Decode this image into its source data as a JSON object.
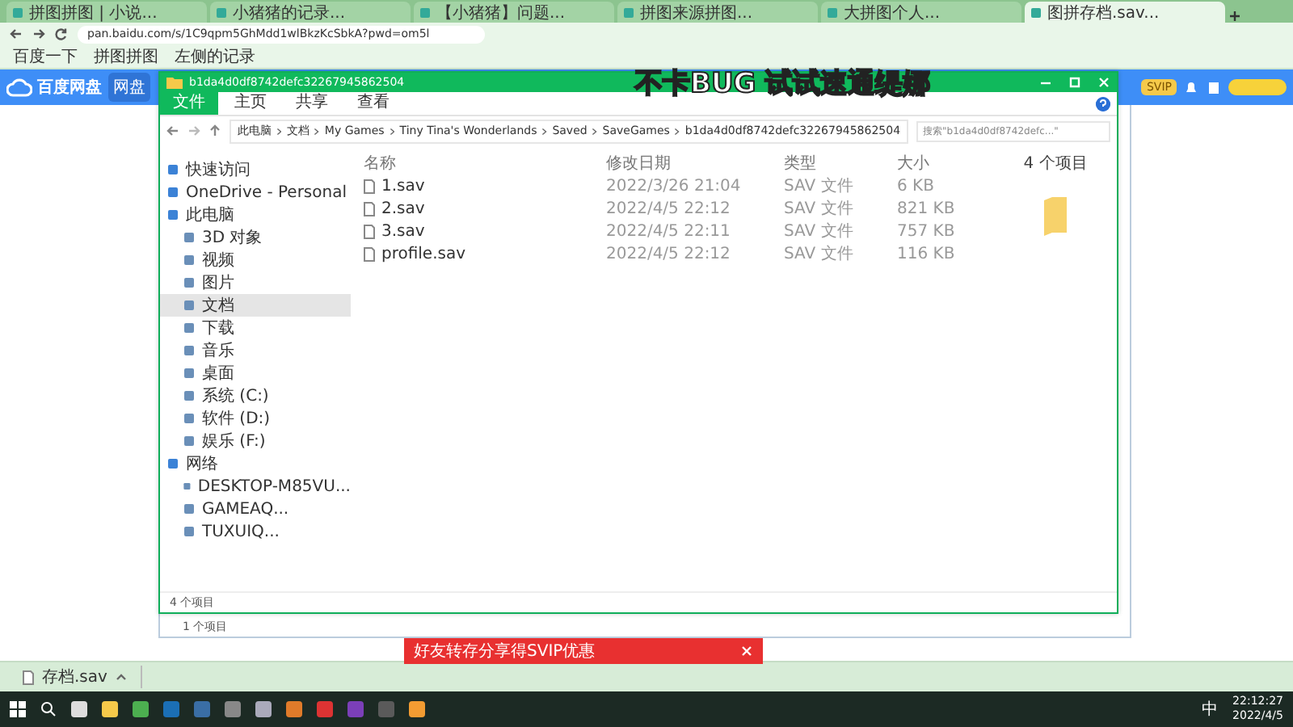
{
  "browser": {
    "tabs": [
      {
        "label": "拼图拼图 | 小说...",
        "selected": false
      },
      {
        "label": "小猪猪的记录...",
        "selected": false
      },
      {
        "label": "【小猪猪】问题...",
        "selected": false
      },
      {
        "label": "拼图来源拼图...",
        "selected": false
      },
      {
        "label": "大拼图个人...",
        "selected": false
      },
      {
        "label": "图拼存档.sav...",
        "selected": true
      }
    ],
    "address": "pan.baidu.com/s/1C9qpm5GhMdd1wlBkzKcSbkA?pwd=om5l",
    "bookmarks": [
      "百度一下",
      "拼图拼图",
      "左侧的记录"
    ]
  },
  "baidu": {
    "logo": "百度网盘",
    "nav": [
      {
        "label": "网盘",
        "selected": true
      }
    ],
    "badge": "SVIP"
  },
  "caption": "不卡BUG 试试速通缇娜",
  "explorer": {
    "title": "b1da4d0df8742defc32267945862504",
    "ribbon": [
      {
        "label": "文件",
        "selected": true
      },
      {
        "label": "主页",
        "selected": false
      },
      {
        "label": "共享",
        "selected": false
      },
      {
        "label": "查看",
        "selected": false
      }
    ],
    "breadcrumb": [
      "此电脑",
      "文档",
      "My Games",
      "Tiny Tina's Wonderlands",
      "Saved",
      "SaveGames",
      "b1da4d0df8742defc32267945862504"
    ],
    "search": {
      "placeholder": "搜索\"b1da4d0df8742defc...\""
    },
    "tree": [
      {
        "label": "快速访问",
        "selected": false
      },
      {
        "label": "OneDrive - Personal",
        "selected": false
      },
      {
        "label": "此电脑",
        "selected": false,
        "children": [
          {
            "label": "3D 对象",
            "selected": false
          },
          {
            "label": "视频",
            "selected": false
          },
          {
            "label": "图片",
            "selected": false
          },
          {
            "label": "文档",
            "selected": true
          },
          {
            "label": "下载",
            "selected": false
          },
          {
            "label": "音乐",
            "selected": false
          },
          {
            "label": "桌面",
            "selected": false
          },
          {
            "label": "系统 (C:)",
            "selected": false
          },
          {
            "label": "软件 (D:)",
            "selected": false
          },
          {
            "label": "娱乐 (F:)",
            "selected": false
          }
        ]
      },
      {
        "label": "网络",
        "selected": false,
        "children": [
          {
            "label": "DESKTOP-M85VU...",
            "selected": false
          },
          {
            "label": "GAMEAQ...",
            "selected": false
          },
          {
            "label": "TUXUIQ...",
            "selected": false
          }
        ]
      }
    ],
    "columns": [
      "名称",
      "修改日期",
      "类型",
      "大小"
    ],
    "rows": [
      {
        "name": "1.sav",
        "date": "2022/3/26 21:04",
        "type": "SAV 文件",
        "size": "6 KB",
        "selected": false
      },
      {
        "name": "2.sav",
        "date": "2022/4/5 22:12",
        "type": "SAV 文件",
        "size": "821 KB",
        "selected": false
      },
      {
        "name": "3.sav",
        "date": "2022/4/5 22:11",
        "type": "SAV 文件",
        "size": "757 KB",
        "selected": false
      },
      {
        "name": "profile.sav",
        "date": "2022/4/5 22:12",
        "type": "SAV 文件",
        "size": "116 KB",
        "selected": false
      }
    ],
    "details": "4 个项目",
    "status": "4 个项目"
  },
  "back_window": {
    "status": "1 个项目"
  },
  "ad": {
    "text": "好友转存分享得SVIP优惠"
  },
  "download": {
    "file": "存档.sav"
  },
  "taskbar": {
    "ime": "中",
    "time": "22:12:27",
    "date": "2022/4/5"
  }
}
